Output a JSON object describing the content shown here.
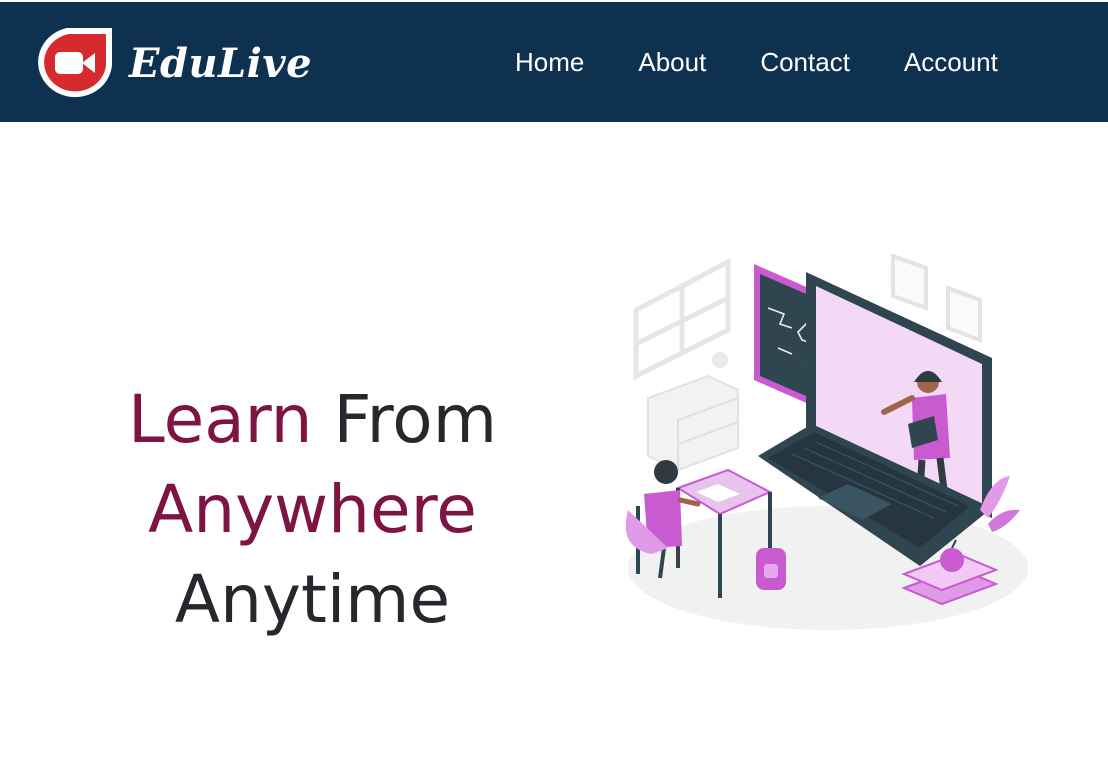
{
  "colors": {
    "navbar_bg": "#0e3150",
    "accent": "#7d1442",
    "text": "#25282c",
    "logo_red": "#d62a2f",
    "illustration_purple": "#c95bd1",
    "illustration_dark": "#2f4550"
  },
  "brand": {
    "name": "EduLive",
    "logo_icon": "video-camera-icon"
  },
  "nav": {
    "items": [
      {
        "label": "Home"
      },
      {
        "label": "About"
      },
      {
        "label": "Contact"
      },
      {
        "label": "Account"
      }
    ]
  },
  "hero": {
    "line1_accent": "Learn",
    "line1_rest": " From",
    "line2_accent": "Anywhere",
    "line3": "Anytime"
  },
  "illustration": {
    "icon": "online-class-illustration"
  }
}
